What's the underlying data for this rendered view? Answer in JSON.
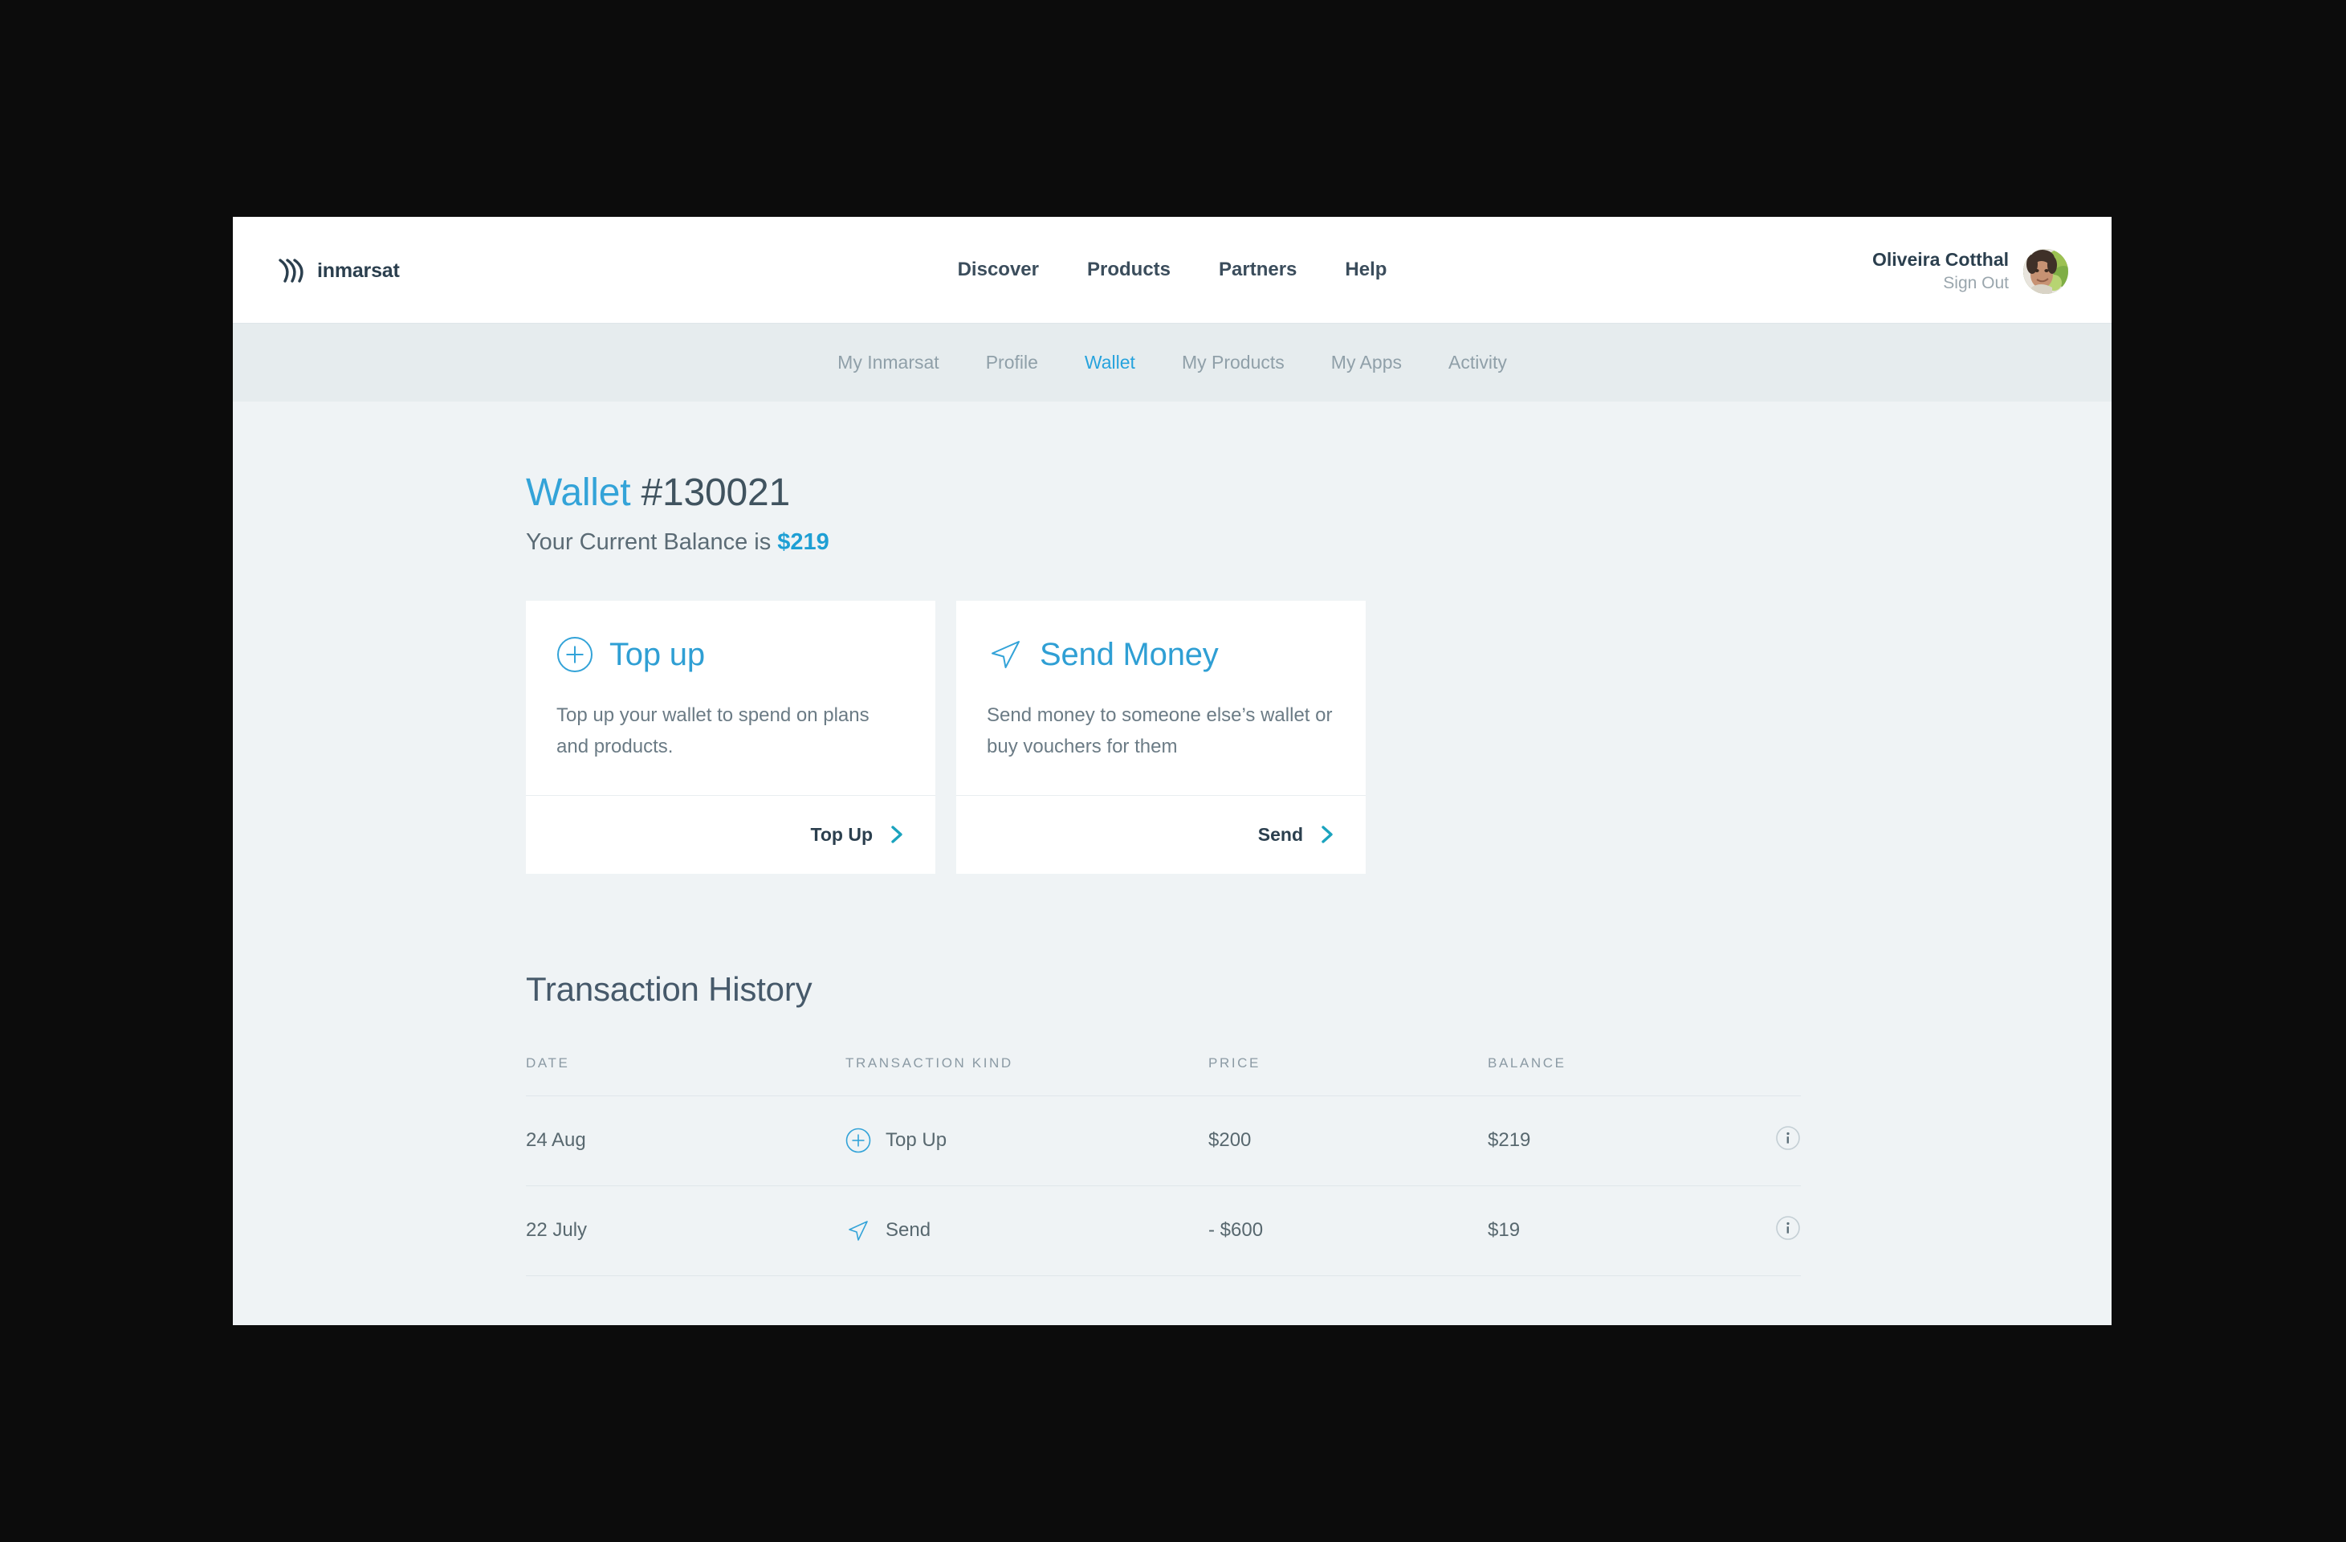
{
  "header": {
    "brand": {
      "name": "inmarsat",
      "mark_icon": "inmarsat-signal-waves-icon"
    },
    "nav": [
      {
        "label": "Discover"
      },
      {
        "label": "Products"
      },
      {
        "label": "Partners"
      },
      {
        "label": "Help"
      }
    ],
    "user": {
      "name": "Oliveira Cotthal",
      "sign_out_label": "Sign Out",
      "avatar_icon": "user-avatar-photo"
    }
  },
  "sub_nav": {
    "items": [
      {
        "label": "My Inmarsat",
        "active": false
      },
      {
        "label": "Profile",
        "active": false
      },
      {
        "label": "Wallet",
        "active": true
      },
      {
        "label": "My Products",
        "active": false
      },
      {
        "label": "My Apps",
        "active": false
      },
      {
        "label": "Activity",
        "active": false
      }
    ]
  },
  "wallet": {
    "title_accent": "Wallet",
    "title_number": "#130021",
    "balance_prefix": "Your Current Balance is",
    "balance_amount": "$219"
  },
  "cards": [
    {
      "icon": "circle-plus-icon",
      "title": "Top up",
      "description": "Top up your wallet to spend on plans and products.",
      "action_label": "Top Up",
      "action_icon": "chevron-right-icon"
    },
    {
      "icon": "send-arrow-icon",
      "title": "Send Money",
      "description": "Send money to someone else’s wallet or buy vouchers for them",
      "action_label": "Send",
      "action_icon": "chevron-right-icon"
    }
  ],
  "history": {
    "title": "Transaction History",
    "columns": [
      "DATE",
      "TRANSACTION KIND",
      "PRICE",
      "BALANCE",
      ""
    ],
    "rows": [
      {
        "date": "24 Aug",
        "kind": "Top Up",
        "kind_icon": "circle-plus-icon",
        "price": "$200",
        "balance": "$219",
        "info_icon": "info-circle-icon"
      },
      {
        "date": "22 July",
        "kind": "Send",
        "kind_icon": "send-arrow-icon",
        "price": "- $600",
        "balance": "$19",
        "info_icon": "info-circle-icon"
      }
    ]
  },
  "colors": {
    "accent_cyan": "#33a3d8",
    "accent_teal": "#1ba3be",
    "brand_navy": "#2b3f4e",
    "page_bg": "#eff3f5",
    "subnav_bg": "#e6ecee",
    "card_bg": "#ffffff",
    "body_text": "#6b7b85",
    "muted_text": "#90a0a9",
    "outer_bg": "#0c0c0c"
  }
}
